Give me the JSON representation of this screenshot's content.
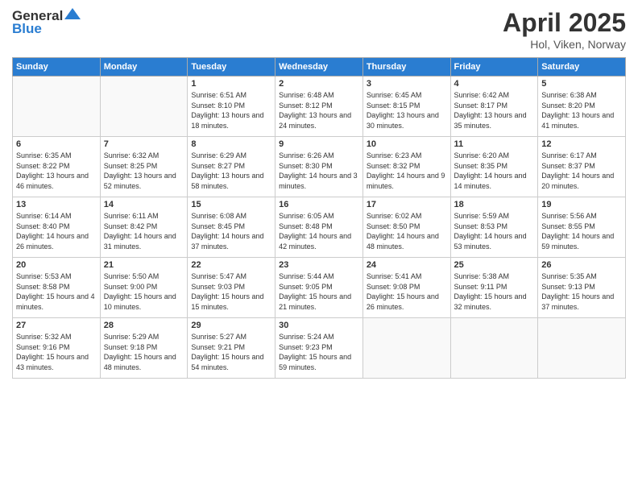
{
  "logo": {
    "line1": "General",
    "line2": "Blue"
  },
  "title": "April 2025",
  "location": "Hol, Viken, Norway",
  "weekdays": [
    "Sunday",
    "Monday",
    "Tuesday",
    "Wednesday",
    "Thursday",
    "Friday",
    "Saturday"
  ],
  "weeks": [
    [
      {
        "day": "",
        "info": ""
      },
      {
        "day": "",
        "info": ""
      },
      {
        "day": "1",
        "info": "Sunrise: 6:51 AM\nSunset: 8:10 PM\nDaylight: 13 hours and 18 minutes."
      },
      {
        "day": "2",
        "info": "Sunrise: 6:48 AM\nSunset: 8:12 PM\nDaylight: 13 hours and 24 minutes."
      },
      {
        "day": "3",
        "info": "Sunrise: 6:45 AM\nSunset: 8:15 PM\nDaylight: 13 hours and 30 minutes."
      },
      {
        "day": "4",
        "info": "Sunrise: 6:42 AM\nSunset: 8:17 PM\nDaylight: 13 hours and 35 minutes."
      },
      {
        "day": "5",
        "info": "Sunrise: 6:38 AM\nSunset: 8:20 PM\nDaylight: 13 hours and 41 minutes."
      }
    ],
    [
      {
        "day": "6",
        "info": "Sunrise: 6:35 AM\nSunset: 8:22 PM\nDaylight: 13 hours and 46 minutes."
      },
      {
        "day": "7",
        "info": "Sunrise: 6:32 AM\nSunset: 8:25 PM\nDaylight: 13 hours and 52 minutes."
      },
      {
        "day": "8",
        "info": "Sunrise: 6:29 AM\nSunset: 8:27 PM\nDaylight: 13 hours and 58 minutes."
      },
      {
        "day": "9",
        "info": "Sunrise: 6:26 AM\nSunset: 8:30 PM\nDaylight: 14 hours and 3 minutes."
      },
      {
        "day": "10",
        "info": "Sunrise: 6:23 AM\nSunset: 8:32 PM\nDaylight: 14 hours and 9 minutes."
      },
      {
        "day": "11",
        "info": "Sunrise: 6:20 AM\nSunset: 8:35 PM\nDaylight: 14 hours and 14 minutes."
      },
      {
        "day": "12",
        "info": "Sunrise: 6:17 AM\nSunset: 8:37 PM\nDaylight: 14 hours and 20 minutes."
      }
    ],
    [
      {
        "day": "13",
        "info": "Sunrise: 6:14 AM\nSunset: 8:40 PM\nDaylight: 14 hours and 26 minutes."
      },
      {
        "day": "14",
        "info": "Sunrise: 6:11 AM\nSunset: 8:42 PM\nDaylight: 14 hours and 31 minutes."
      },
      {
        "day": "15",
        "info": "Sunrise: 6:08 AM\nSunset: 8:45 PM\nDaylight: 14 hours and 37 minutes."
      },
      {
        "day": "16",
        "info": "Sunrise: 6:05 AM\nSunset: 8:48 PM\nDaylight: 14 hours and 42 minutes."
      },
      {
        "day": "17",
        "info": "Sunrise: 6:02 AM\nSunset: 8:50 PM\nDaylight: 14 hours and 48 minutes."
      },
      {
        "day": "18",
        "info": "Sunrise: 5:59 AM\nSunset: 8:53 PM\nDaylight: 14 hours and 53 minutes."
      },
      {
        "day": "19",
        "info": "Sunrise: 5:56 AM\nSunset: 8:55 PM\nDaylight: 14 hours and 59 minutes."
      }
    ],
    [
      {
        "day": "20",
        "info": "Sunrise: 5:53 AM\nSunset: 8:58 PM\nDaylight: 15 hours and 4 minutes."
      },
      {
        "day": "21",
        "info": "Sunrise: 5:50 AM\nSunset: 9:00 PM\nDaylight: 15 hours and 10 minutes."
      },
      {
        "day": "22",
        "info": "Sunrise: 5:47 AM\nSunset: 9:03 PM\nDaylight: 15 hours and 15 minutes."
      },
      {
        "day": "23",
        "info": "Sunrise: 5:44 AM\nSunset: 9:05 PM\nDaylight: 15 hours and 21 minutes."
      },
      {
        "day": "24",
        "info": "Sunrise: 5:41 AM\nSunset: 9:08 PM\nDaylight: 15 hours and 26 minutes."
      },
      {
        "day": "25",
        "info": "Sunrise: 5:38 AM\nSunset: 9:11 PM\nDaylight: 15 hours and 32 minutes."
      },
      {
        "day": "26",
        "info": "Sunrise: 5:35 AM\nSunset: 9:13 PM\nDaylight: 15 hours and 37 minutes."
      }
    ],
    [
      {
        "day": "27",
        "info": "Sunrise: 5:32 AM\nSunset: 9:16 PM\nDaylight: 15 hours and 43 minutes."
      },
      {
        "day": "28",
        "info": "Sunrise: 5:29 AM\nSunset: 9:18 PM\nDaylight: 15 hours and 48 minutes."
      },
      {
        "day": "29",
        "info": "Sunrise: 5:27 AM\nSunset: 9:21 PM\nDaylight: 15 hours and 54 minutes."
      },
      {
        "day": "30",
        "info": "Sunrise: 5:24 AM\nSunset: 9:23 PM\nDaylight: 15 hours and 59 minutes."
      },
      {
        "day": "",
        "info": ""
      },
      {
        "day": "",
        "info": ""
      },
      {
        "day": "",
        "info": ""
      }
    ]
  ]
}
